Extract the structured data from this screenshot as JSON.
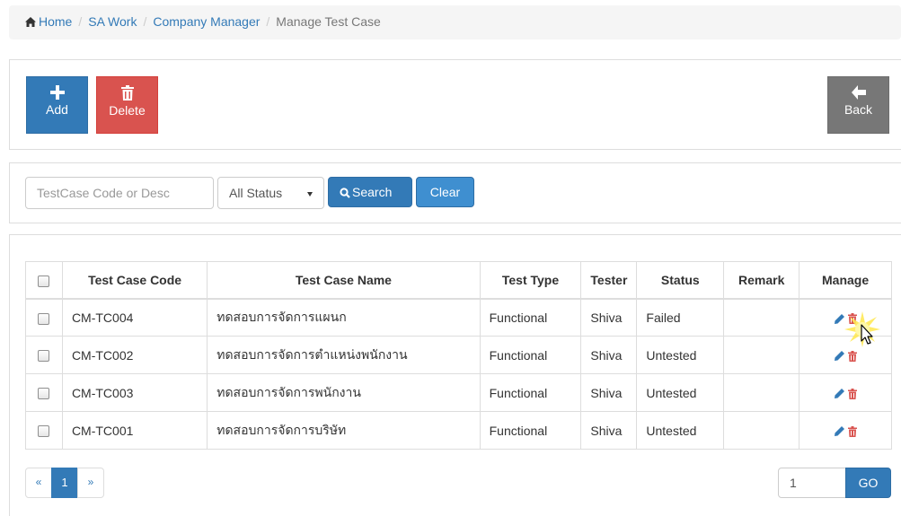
{
  "breadcrumb": {
    "items": [
      "Home",
      "SA Work",
      "Company Manager",
      "Manage Test Case"
    ],
    "icon": "home-icon"
  },
  "actions": {
    "add_label": "Add",
    "delete_label": "Delete",
    "back_label": "Back"
  },
  "search": {
    "placeholder": "TestCase Code or Desc",
    "status_selected": "All Status",
    "search_label": "Search",
    "clear_label": "Clear"
  },
  "table": {
    "columns": [
      "Test Case Code",
      "Test Case Name",
      "Test Type",
      "Tester",
      "Status",
      "Remark",
      "Manage"
    ],
    "rows": [
      {
        "code": "CM-TC004",
        "name": "ทดสอบการจัดการแผนก",
        "type": "Functional",
        "tester": "Shiva",
        "status": "Failed",
        "remark": ""
      },
      {
        "code": "CM-TC002",
        "name": "ทดสอบการจัดการตำแหน่งพนักงาน",
        "type": "Functional",
        "tester": "Shiva",
        "status": "Untested",
        "remark": ""
      },
      {
        "code": "CM-TC003",
        "name": "ทดสอบการจัดการพนักงาน",
        "type": "Functional",
        "tester": "Shiva",
        "status": "Untested",
        "remark": ""
      },
      {
        "code": "CM-TC001",
        "name": "ทดสอบการจัดการบริษัท",
        "type": "Functional",
        "tester": "Shiva",
        "status": "Untested",
        "remark": ""
      }
    ]
  },
  "pagination": {
    "prev": "«",
    "current": "1",
    "next": "»",
    "goto_value": "1",
    "go_label": "GO"
  },
  "colors": {
    "primary": "#337ab7",
    "danger": "#d9534f",
    "default_dark": "#777777"
  }
}
